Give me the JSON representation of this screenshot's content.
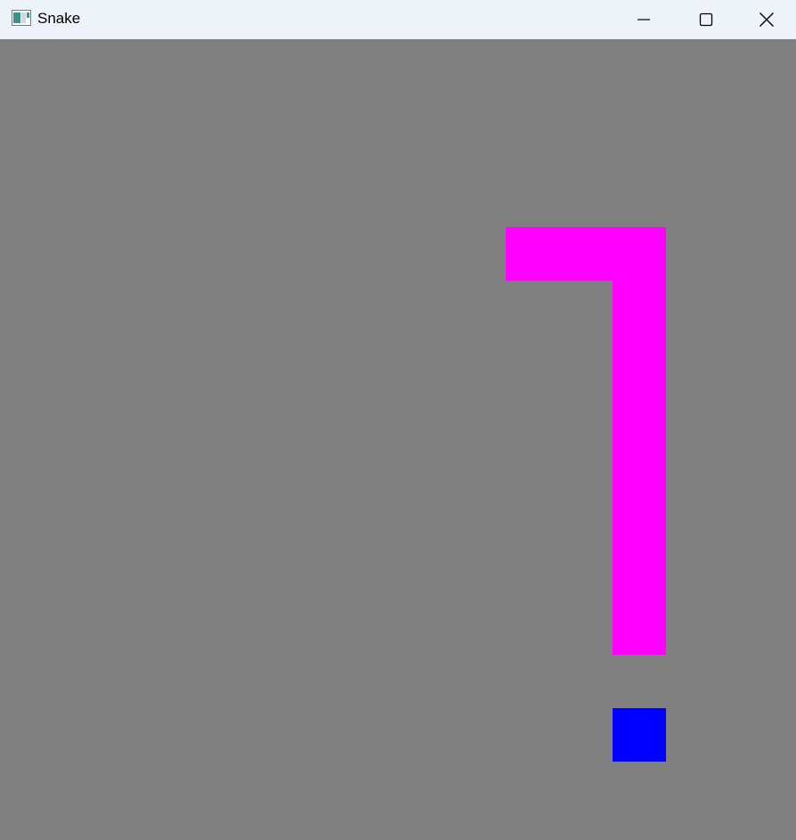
{
  "window": {
    "title": "Snake",
    "app_icon": "app-window-icon",
    "controls": {
      "minimize_icon": "minimize-icon",
      "maximize_icon": "maximize-icon",
      "close_icon": "close-icon"
    }
  },
  "game": {
    "background_color": "#808080",
    "snake_color": "#ff00ff",
    "food_color": "#0000ff",
    "grid": {
      "cols": 15,
      "rows": 15
    },
    "snake": [
      [
        9,
        3
      ],
      [
        10,
        3
      ],
      [
        11,
        3
      ],
      [
        11,
        4
      ],
      [
        11,
        5
      ],
      [
        11,
        6
      ],
      [
        11,
        7
      ],
      [
        11,
        8
      ],
      [
        11,
        9
      ],
      [
        11,
        10
      ]
    ],
    "food": [
      11,
      12
    ]
  }
}
